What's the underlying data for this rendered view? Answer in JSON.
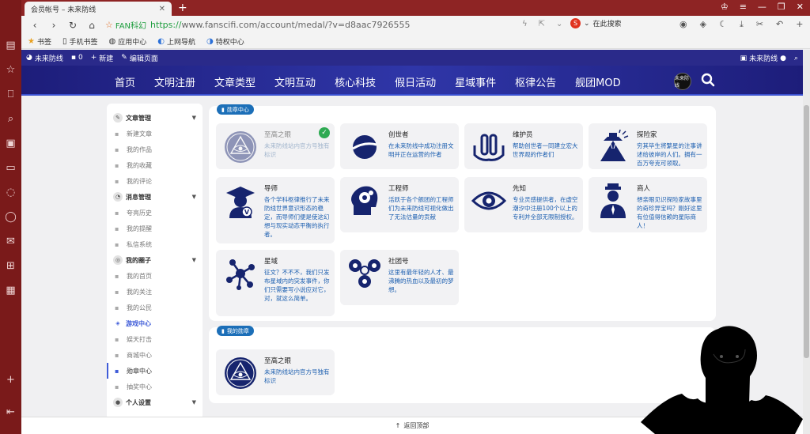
{
  "browser": {
    "tab_title": "会员帐号 – 未来防线",
    "url_site_name": "FAN科幻",
    "url_scheme": "https://",
    "url_rest": "www.fanscifi.com/account/medal/?v=d8aac7926555",
    "search_placeholder": "在此搜索"
  },
  "bookmarks": [
    {
      "label": "书签",
      "icon": "star-icon"
    },
    {
      "label": "手机书签",
      "icon": "phone-icon"
    },
    {
      "label": "应用中心",
      "icon": "globe-icon"
    },
    {
      "label": "上网导航",
      "icon": "nav-icon"
    },
    {
      "label": "特权中心",
      "icon": "vip-icon"
    }
  ],
  "wpbar": {
    "site": "未来防线",
    "comments": "0",
    "new": "新建",
    "edit": "编辑页面",
    "user": "未来防线"
  },
  "sitenav": {
    "items": [
      "首页",
      "文明注册",
      "文章类型",
      "文明互动",
      "核心科技",
      "假日活动",
      "星域事件",
      "枢律公告",
      "舰团MOD"
    ],
    "logo_text": "未来防线"
  },
  "left_menu": [
    {
      "type": "group",
      "label": "文章管理",
      "icon": "pen-icon"
    },
    {
      "type": "item",
      "label": "新建文章"
    },
    {
      "type": "item",
      "label": "我的作品"
    },
    {
      "type": "item",
      "label": "我的收藏"
    },
    {
      "type": "item",
      "label": "我的评论"
    },
    {
      "type": "group",
      "label": "消息管理",
      "icon": "bell-icon"
    },
    {
      "type": "item",
      "label": "夸亮历史"
    },
    {
      "type": "item",
      "label": "我的提醒"
    },
    {
      "type": "item",
      "label": "私信系统"
    },
    {
      "type": "group",
      "label": "我的圈子",
      "icon": "circle-icon"
    },
    {
      "type": "item",
      "label": "我的首页"
    },
    {
      "type": "item",
      "label": "我的关注"
    },
    {
      "type": "item",
      "label": "我的公民"
    },
    {
      "type": "group_hl",
      "label": "游戏中心",
      "icon": "game-icon"
    },
    {
      "type": "item",
      "label": "娱天打击"
    },
    {
      "type": "item",
      "label": "商城中心"
    },
    {
      "type": "item_active",
      "label": "勋章中心"
    },
    {
      "type": "item",
      "label": "抽奖中心"
    },
    {
      "type": "group",
      "label": "个人设置",
      "icon": "user-icon"
    }
  ],
  "medal_center": {
    "title": "勋章中心",
    "medals": [
      {
        "name": "至高之眼",
        "desc": "未来防线站内官方号独有标识",
        "owned": true,
        "icon": "eye-triangle-icon"
      },
      {
        "name": "创世者",
        "desc": "在未来防线中成功注册文明并正在运营的作者",
        "owned": false,
        "icon": "planet-icon"
      },
      {
        "name": "维护员",
        "desc": "帮助创世者一同建立宏大世界观的作者们",
        "owned": false,
        "icon": "hands-icon"
      },
      {
        "name": "探险家",
        "desc": "穷其毕生将繁星的注事讲述给彼岸的人们。拥有一百万夸克可领取。",
        "owned": false,
        "icon": "explorer-icon"
      },
      {
        "name": "导师",
        "desc": "各个学科枢律推行了未来防线世界意识形态的稳定，而导师们便是使这幻想与现实动态平衡的执行者。",
        "owned": false,
        "icon": "graduate-icon"
      },
      {
        "name": "工程师",
        "desc": "活跃于各个舰团的工程师们为未来防线可视化做出了无法估量的贡献",
        "owned": false,
        "icon": "brain-gear-icon"
      },
      {
        "name": "先知",
        "desc": "专业灵感提供者，在虚空潮汐中注册100个以上的专利并全部无限制授权。",
        "owned": false,
        "icon": "eye-icon"
      },
      {
        "name": "商人",
        "desc": "想亲眼见识探险家故事里的奇珍异宝吗？刚好这里有位值得信赖的星际商人！",
        "owned": false,
        "icon": "merchant-icon"
      },
      {
        "name": "星域",
        "desc": "征文？不不不，我们只发布星域内的突发事件，你们只需要写小说应对它，对，就这么简单。",
        "owned": false,
        "icon": "network-icon"
      },
      {
        "name": "社团号",
        "desc": "这里有最年轻的人才、最沸腾的热血以及最初的梦想。",
        "owned": false,
        "icon": "triangle-dots-icon"
      }
    ]
  },
  "my_medals": {
    "title": "我的勋章",
    "medals": [
      {
        "name": "至高之眼",
        "desc": "未来防线站内官方号独有标识",
        "icon": "eye-triangle-icon"
      }
    ]
  },
  "footer": {
    "back_to_top": "返回顶部"
  },
  "colors": {
    "accent": "#1c5fb0",
    "nav_bg": "#2a2a8a",
    "tab_bar": "#8e2424",
    "icon_navy": "#16246e",
    "owned_check": "#2eaa52"
  }
}
